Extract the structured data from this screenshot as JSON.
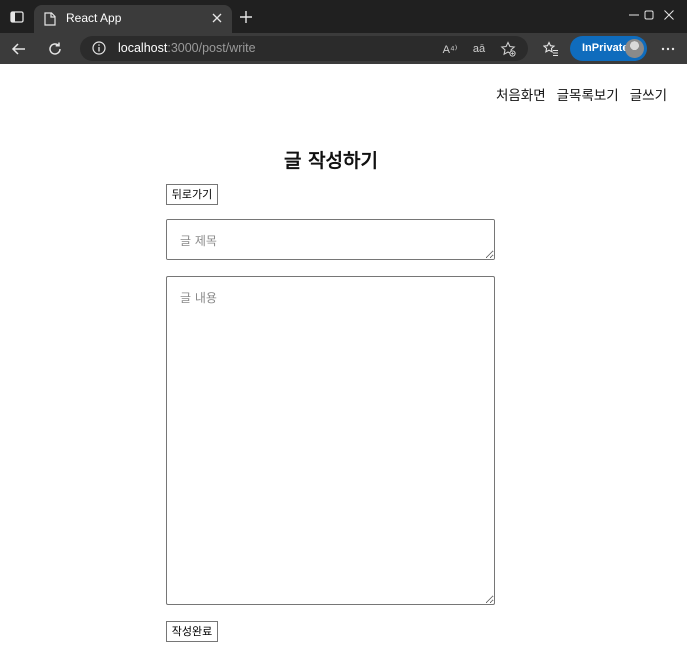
{
  "browser": {
    "tab_title": "React App",
    "url_host": "localhost",
    "url_path": ":3000/post/write",
    "read_aloud_label": "A⁴⁾",
    "translate_label": "aā",
    "inprivate_label": "InPrivate"
  },
  "nav": {
    "items": [
      "처음화면",
      "글목록보기",
      "글쓰기"
    ]
  },
  "page": {
    "heading": "글 작성하기",
    "back_button": "뒤로가기",
    "title_placeholder": "글 제목",
    "content_placeholder": "글 내용",
    "submit_button": "작성완료"
  },
  "colors": {
    "chrome_dark": "#202020",
    "chrome_toolbar": "#3b3b3b",
    "inprivate_accent": "#0f6cbd"
  }
}
